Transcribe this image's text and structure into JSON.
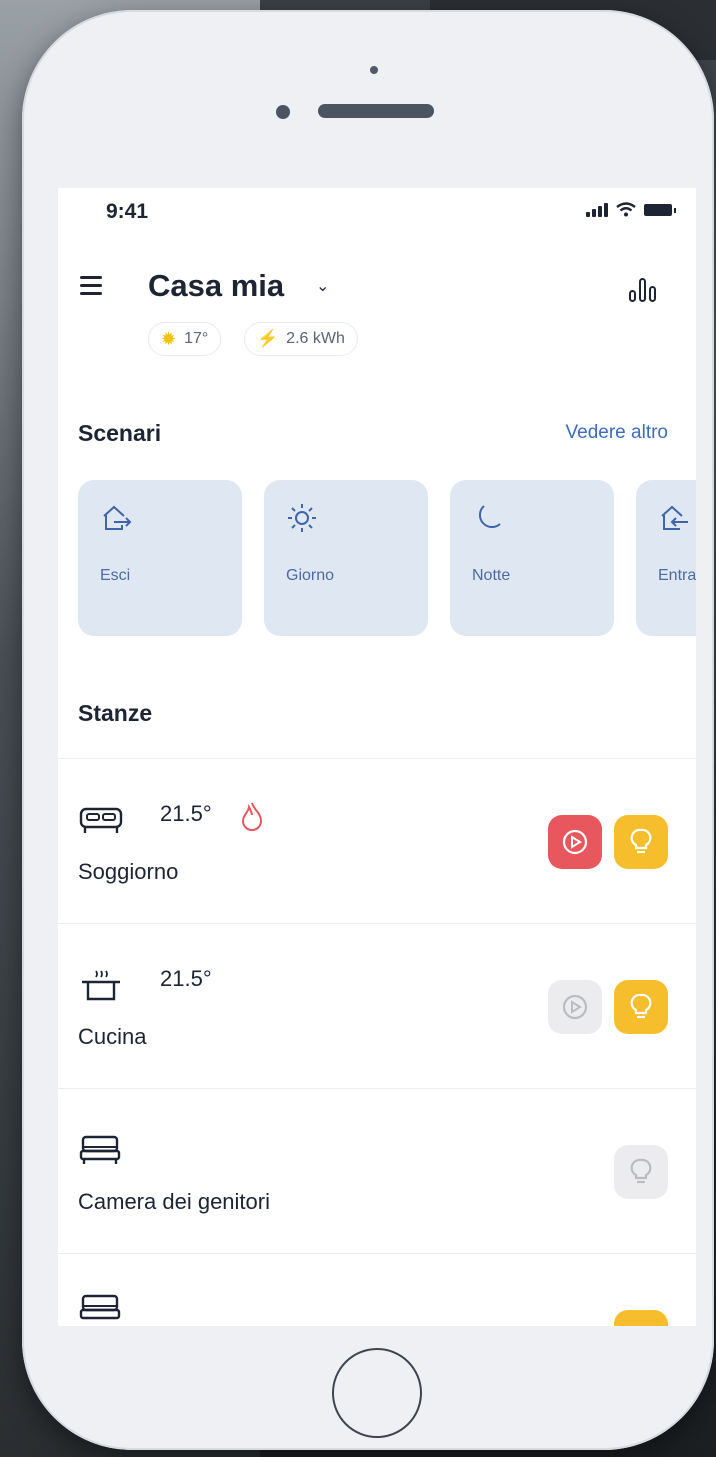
{
  "status_bar": {
    "time": "9:41"
  },
  "header": {
    "home_name": "Casa mia",
    "weather_value": "17°",
    "energy_value": "2.6 kWh"
  },
  "scenes": {
    "title": "Scenari",
    "see_more": "Vedere altro",
    "items": [
      {
        "label": "Esci",
        "icon": "leave-home-icon"
      },
      {
        "label": "Giorno",
        "icon": "sun-icon"
      },
      {
        "label": "Notte",
        "icon": "moon-icon"
      },
      {
        "label": "Entra",
        "icon": "enter-home-icon"
      }
    ]
  },
  "rooms": {
    "title": "Stanze",
    "items": [
      {
        "name": "Soggiorno",
        "temperature": "21.5°",
        "icon": "sofa-icon",
        "heating": true,
        "media_on": true,
        "light_on": true
      },
      {
        "name": "Cucina",
        "temperature": "21.5°",
        "icon": "cooking-pot-icon",
        "heating": false,
        "media_on": false,
        "light_on": true
      },
      {
        "name": "Camera dei genitori",
        "icon": "bed-icon",
        "light_on": false
      },
      {
        "name": "",
        "icon": "bed-icon",
        "light_on": true
      }
    ]
  },
  "colors": {
    "media_active": "#e8565e",
    "light_active": "#f6be2c",
    "scene_background": "#dfe7f3",
    "accent_link": "#3d6bc4"
  }
}
